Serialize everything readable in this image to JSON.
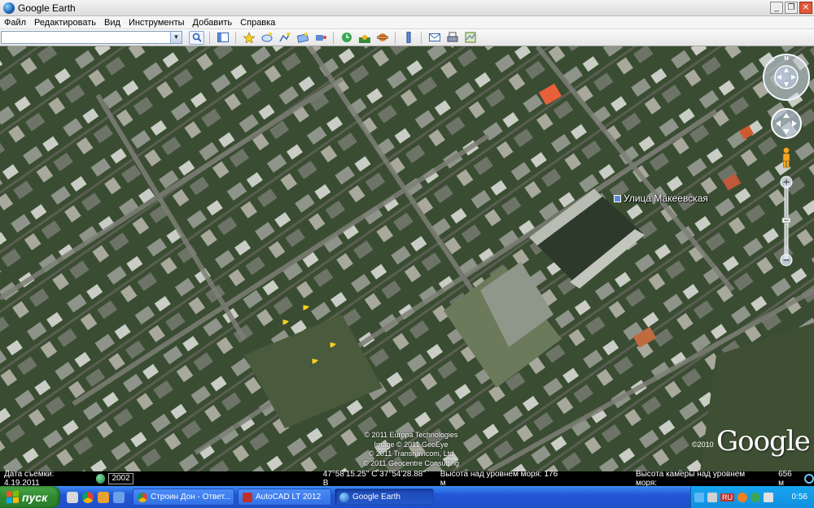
{
  "window": {
    "title": "Google Earth",
    "buttons": [
      "_",
      "❐",
      "✕"
    ]
  },
  "menu": [
    "Файл",
    "Редактировать",
    "Вид",
    "Инструменты",
    "Добавить",
    "Справка"
  ],
  "toolbar": {
    "search_value": "",
    "search_button_icon": "search-icon",
    "tools": [
      "sidebar-toggle-icon",
      "placemark-icon",
      "polygon-icon",
      "path-icon",
      "image-overlay-icon",
      "record-tour-icon",
      "historical-imagery-icon",
      "sunlight-icon",
      "planets-icon",
      "ruler-icon",
      "email-icon",
      "print-icon",
      "view-in-maps-icon"
    ]
  },
  "map": {
    "place_label": "Улица Макеевская",
    "copyright": [
      "© 2011 Europa Technologies",
      "Image © 2011 GeoEye",
      "© 2011 Transnavicom, Ltd",
      "© 2011 Geocentre Consulting"
    ],
    "logo": "Google",
    "logo_year": "©2010",
    "compass_north": "N"
  },
  "status": {
    "date": "Дата съемки: 4.19.2011",
    "year": "2002",
    "coords": "47°58'15.25\" С   37°54'28.88\" В",
    "elevation": "Высота над уровнем моря:  176 м",
    "eye_label": "Высота камеры над уровнем моря:",
    "eye_value": "656 м"
  },
  "taskbar": {
    "start": "пуск",
    "tasks": [
      "Строин Дон - Ответ...",
      "AutoCAD LT 2012",
      "Google Earth"
    ],
    "clock": "0:56",
    "lang": "RU"
  },
  "colors": {
    "accent_orange": "#e8603a",
    "task_blue": "#3271e6",
    "start_green": "#2f8a2f"
  }
}
